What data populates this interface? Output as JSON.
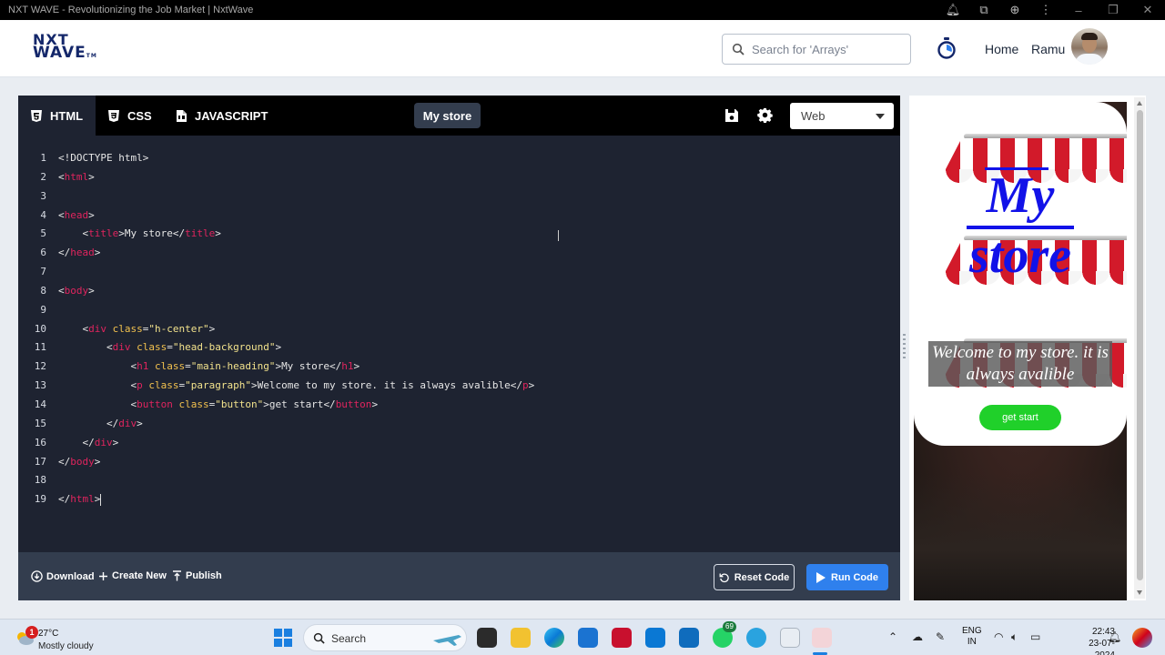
{
  "window": {
    "title": "NXT WAVE - Revolutionizing the Job Market | NxtWave"
  },
  "header": {
    "logo": {
      "line1": "NXT",
      "line2": "WAVE",
      "tm": "TM"
    },
    "search_placeholder": "Search for 'Arrays'",
    "nav_home": "Home",
    "user_name": "Ramu"
  },
  "editor": {
    "tabs": [
      {
        "label": "HTML",
        "icon": "html5-icon",
        "active": true
      },
      {
        "label": "CSS",
        "icon": "css3-icon",
        "active": false
      },
      {
        "label": "JAVASCRIPT",
        "icon": "js-file-icon",
        "active": false
      }
    ],
    "file_name": "My store",
    "view_mode": "Web",
    "line_numbers": [
      "1",
      "2",
      "3",
      "4",
      "5",
      "6",
      "7",
      "8",
      "9",
      "10",
      "11",
      "12",
      "13",
      "14",
      "15",
      "16",
      "17",
      "18",
      "19"
    ],
    "code": {
      "l1": "<!DOCTYPE html>",
      "l2_tag": "html",
      "l4_tag": "head",
      "l5_tag": "title",
      "l5_text": "My store",
      "l8_tag": "body",
      "l10_tag": "div",
      "l10_attr": "class",
      "l10_val": "\"h-center\"",
      "l11_val": "\"head-background\"",
      "l12_tag": "h1",
      "l12_val": "\"main-heading\"",
      "l12_text": "My store",
      "l13_tag": "p",
      "l13_val": "\"paragraph\"",
      "l13_text": "Welcome to my store. it is always avalible",
      "l14_tag": "button",
      "l14_val": "\"button\"",
      "l14_text": "get start"
    },
    "footer": {
      "download": "Download",
      "create_new": "Create New",
      "publish": "Publish",
      "reset": "Reset Code",
      "run": "Run Code"
    }
  },
  "preview": {
    "heading_line1": "My",
    "heading_line2": "store",
    "paragraph": "Welcome to my store. it is always avalible",
    "button": "get start"
  },
  "taskbar": {
    "weather_badge": "1",
    "temperature": "27°C",
    "condition": "Mostly cloudy",
    "search_label": "Search",
    "whatsapp_count": "69",
    "lang_line1": "ENG",
    "lang_line2": "IN",
    "time": "22:43",
    "date": "23-07-2024"
  },
  "colors": {
    "accent_blue": "#2f80ed",
    "tag_red": "#e0245e",
    "editor_bg": "#1e2331",
    "heading_blue": "#1212e8",
    "button_green": "#20d02a"
  }
}
